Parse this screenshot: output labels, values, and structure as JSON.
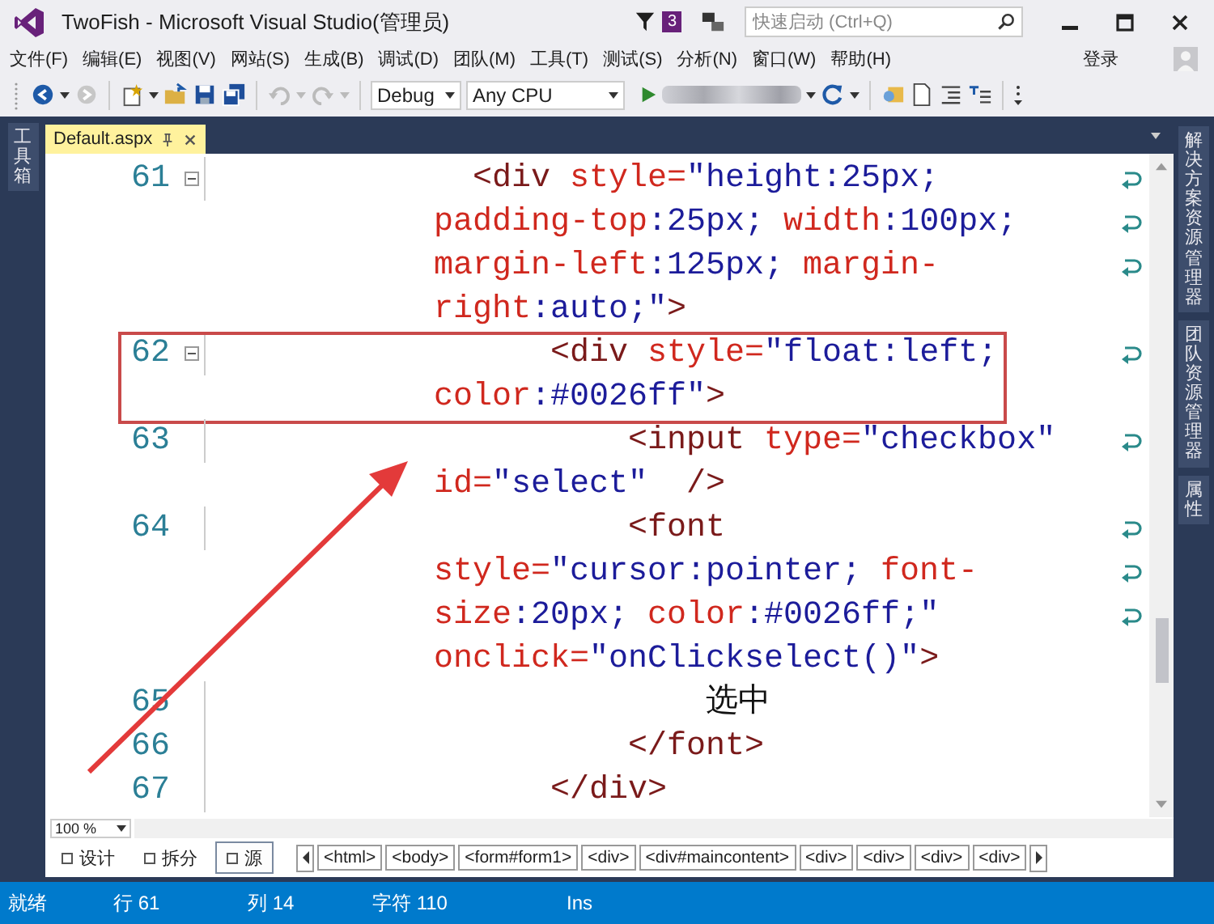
{
  "window": {
    "title": "TwoFish - Microsoft Visual Studio(管理员)",
    "notification_count": "3",
    "quick_launch": {
      "placeholder": "快速启动 (Ctrl+Q)"
    }
  },
  "menu": [
    "文件(F)",
    "编辑(E)",
    "视图(V)",
    "网站(S)",
    "生成(B)",
    "调试(D)",
    "团队(M)",
    "工具(T)",
    "测试(S)",
    "分析(N)",
    "窗口(W)",
    "帮助(H)"
  ],
  "account": {
    "sign_in": "登录"
  },
  "toolbar": {
    "configuration": "Debug",
    "platform": "Any CPU"
  },
  "left_dock": [
    "工具箱"
  ],
  "document_tabs": [
    {
      "label": "Default.aspx",
      "selected": true
    }
  ],
  "right_dock": [
    "解决方案资源管理器",
    "团队资源管理器",
    "属性"
  ],
  "editor": {
    "lines": [
      {
        "number": "61",
        "collapsible": true,
        "highlighted": false,
        "rows": [
          {
            "segments": [
              {
                "kind": "tag",
                "text": "  <div"
              },
              {
                "kind": "attr",
                "text": " style="
              },
              {
                "kind": "value",
                "text": "\"height:25px;"
              }
            ]
          },
          {
            "segments": [
              {
                "kind": "attr",
                "text": "padding-top"
              },
              {
                "kind": "value",
                "text": ":25px;"
              },
              {
                "kind": "attr",
                "text": " width"
              },
              {
                "kind": "value",
                "text": ":100px;"
              }
            ]
          },
          {
            "segments": [
              {
                "kind": "attr",
                "text": "margin-left"
              },
              {
                "kind": "value",
                "text": ":125px;"
              },
              {
                "kind": "attr",
                "text": " margin-"
              }
            ]
          },
          {
            "segments": [
              {
                "kind": "attr",
                "text": "right"
              },
              {
                "kind": "value",
                "text": ":auto;\""
              },
              {
                "kind": "tag",
                "text": ">"
              }
            ]
          }
        ]
      },
      {
        "number": "62",
        "collapsible": true,
        "highlighted": true,
        "rows": [
          {
            "segments": [
              {
                "kind": "tag",
                "text": "      <div"
              },
              {
                "kind": "attr",
                "text": " style="
              },
              {
                "kind": "value",
                "text": "\"float:left;"
              }
            ]
          },
          {
            "segments": [
              {
                "kind": "attr",
                "text": "color"
              },
              {
                "kind": "value",
                "text": ":#0026ff\""
              },
              {
                "kind": "tag",
                "text": ">"
              }
            ]
          }
        ]
      },
      {
        "number": "63",
        "collapsible": false,
        "highlighted": false,
        "rows": [
          {
            "segments": [
              {
                "kind": "tag",
                "text": "          <input"
              },
              {
                "kind": "attr",
                "text": " type="
              },
              {
                "kind": "value",
                "text": "\"checkbox\""
              }
            ]
          },
          {
            "segments": [
              {
                "kind": "attr",
                "text": "id="
              },
              {
                "kind": "value",
                "text": "\"select\""
              },
              {
                "kind": "tag",
                "text": "  />"
              }
            ]
          }
        ]
      },
      {
        "number": "64",
        "collapsible": false,
        "highlighted": false,
        "rows": [
          {
            "segments": [
              {
                "kind": "tag",
                "text": "          <font"
              }
            ]
          },
          {
            "segments": [
              {
                "kind": "attr",
                "text": "style="
              },
              {
                "kind": "value",
                "text": "\"cursor:pointer;"
              },
              {
                "kind": "attr",
                "text": " font-"
              }
            ]
          },
          {
            "segments": [
              {
                "kind": "attr",
                "text": "size"
              },
              {
                "kind": "value",
                "text": ":20px;"
              },
              {
                "kind": "attr",
                "text": " color"
              },
              {
                "kind": "value",
                "text": ":#0026ff;\""
              }
            ]
          },
          {
            "segments": [
              {
                "kind": "attr",
                "text": "onclick="
              },
              {
                "kind": "value",
                "text": "\"onClickselect()\""
              },
              {
                "kind": "tag",
                "text": ">"
              }
            ]
          }
        ]
      },
      {
        "number": "65",
        "collapsible": false,
        "highlighted": false,
        "rows": [
          {
            "segments": [
              {
                "kind": "plain",
                "text": "              选中"
              }
            ]
          }
        ]
      },
      {
        "number": "66",
        "collapsible": false,
        "highlighted": false,
        "rows": [
          {
            "segments": [
              {
                "kind": "tag",
                "text": "          </font>"
              }
            ]
          }
        ]
      },
      {
        "number": "67",
        "collapsible": false,
        "highlighted": false,
        "rows": [
          {
            "segments": [
              {
                "kind": "tag",
                "text": "      </div>"
              }
            ]
          }
        ]
      }
    ]
  },
  "zoom": "100 %",
  "view_tabs": [
    {
      "label": "设计",
      "selected": false
    },
    {
      "label": "拆分",
      "selected": false
    },
    {
      "label": "源",
      "selected": true
    }
  ],
  "breadcrumbs": [
    "<html>",
    "<body>",
    "<form#form1>",
    "<div>",
    "<div#maincontent>",
    "<div>",
    "<div>",
    "<div>",
    "<div>"
  ],
  "status_bar": {
    "state": "就绪",
    "line": "行 61",
    "column": "列 14",
    "chars": "字符 110",
    "mode": "Ins"
  }
}
